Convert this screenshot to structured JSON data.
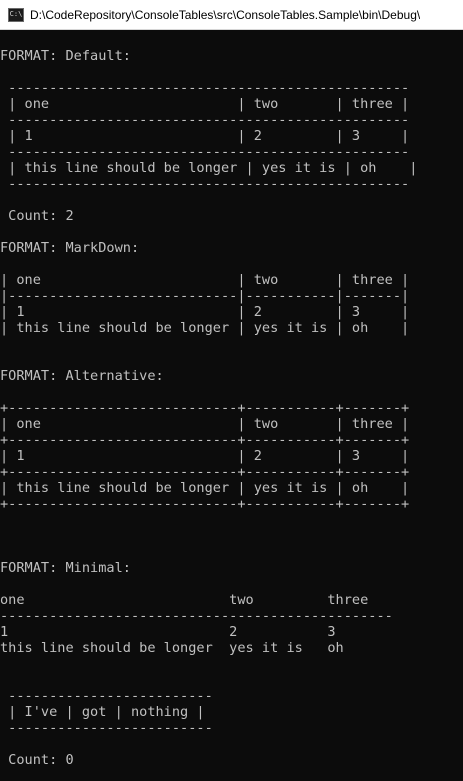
{
  "window": {
    "title": "D:\\CodeRepository\\ConsoleTables\\src\\ConsoleTables.Sample\\bin\\Debug\\",
    "icon_text": "C:\\"
  },
  "console": {
    "lines": [
      "FORMAT: Default:",
      " -------------------------------------------------",
      " | one                       | two       | three |",
      " -------------------------------------------------",
      " | 1                         | 2         | 3     |",
      " -------------------------------------------------",
      " | this line should be longer | yes it is | oh    |",
      " -------------------------------------------------",
      " Count: 2",
      "FORMAT: MarkDown:",
      "| one                        | two       | three |",
      "|----------------------------|-----------|-------|",
      "| 1                          | 2         | 3     |",
      "| this line should be longer | yes it is | oh    |",
      "FORMAT: Alternative:",
      "+----------------------------+-----------+-------+",
      "| one                        | two       | three |",
      "+----------------------------+-----------+-------+",
      "| 1                          | 2         | 3     |",
      "+----------------------------+-----------+-------+",
      "| this line should be longer | yes it is | oh    |",
      "+----------------------------+-----------+-------+",
      "FORMAT: Minimal:",
      "one                         two         three",
      "------------------------------------------------",
      "1                           2           3",
      "this line should be longer  yes it is   oh",
      " -------------------------",
      " | I've | got | nothing |",
      " -------------------------",
      " Count: 0"
    ]
  },
  "colors": {
    "background": "#0c0c0c",
    "text": "#c0c0c0",
    "titlebar": "#ffffff"
  }
}
